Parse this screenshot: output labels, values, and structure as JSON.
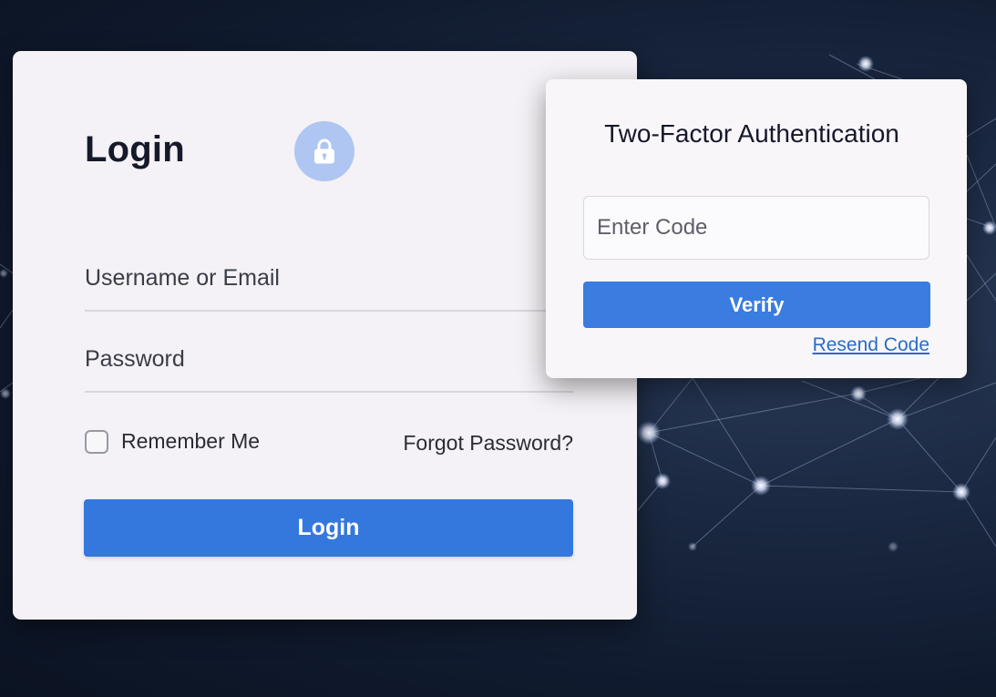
{
  "login": {
    "title": "Login",
    "username_placeholder": "Username or Email",
    "password_placeholder": "Password",
    "remember_label": "Remember Me",
    "forgot_label": "Forgot Password?",
    "button_label": "Login",
    "icon": "lock-icon",
    "icon_badge_color": "#aec6f1",
    "button_color": "#3478de"
  },
  "two_factor": {
    "title": "Two-Factor Authentication",
    "code_placeholder": "Enter Code",
    "verify_label": "Verify",
    "resend_label": "Resend Code",
    "button_color": "#3a7ce0",
    "link_color": "#2a6cc9"
  },
  "background": {
    "color": "#13203a"
  }
}
